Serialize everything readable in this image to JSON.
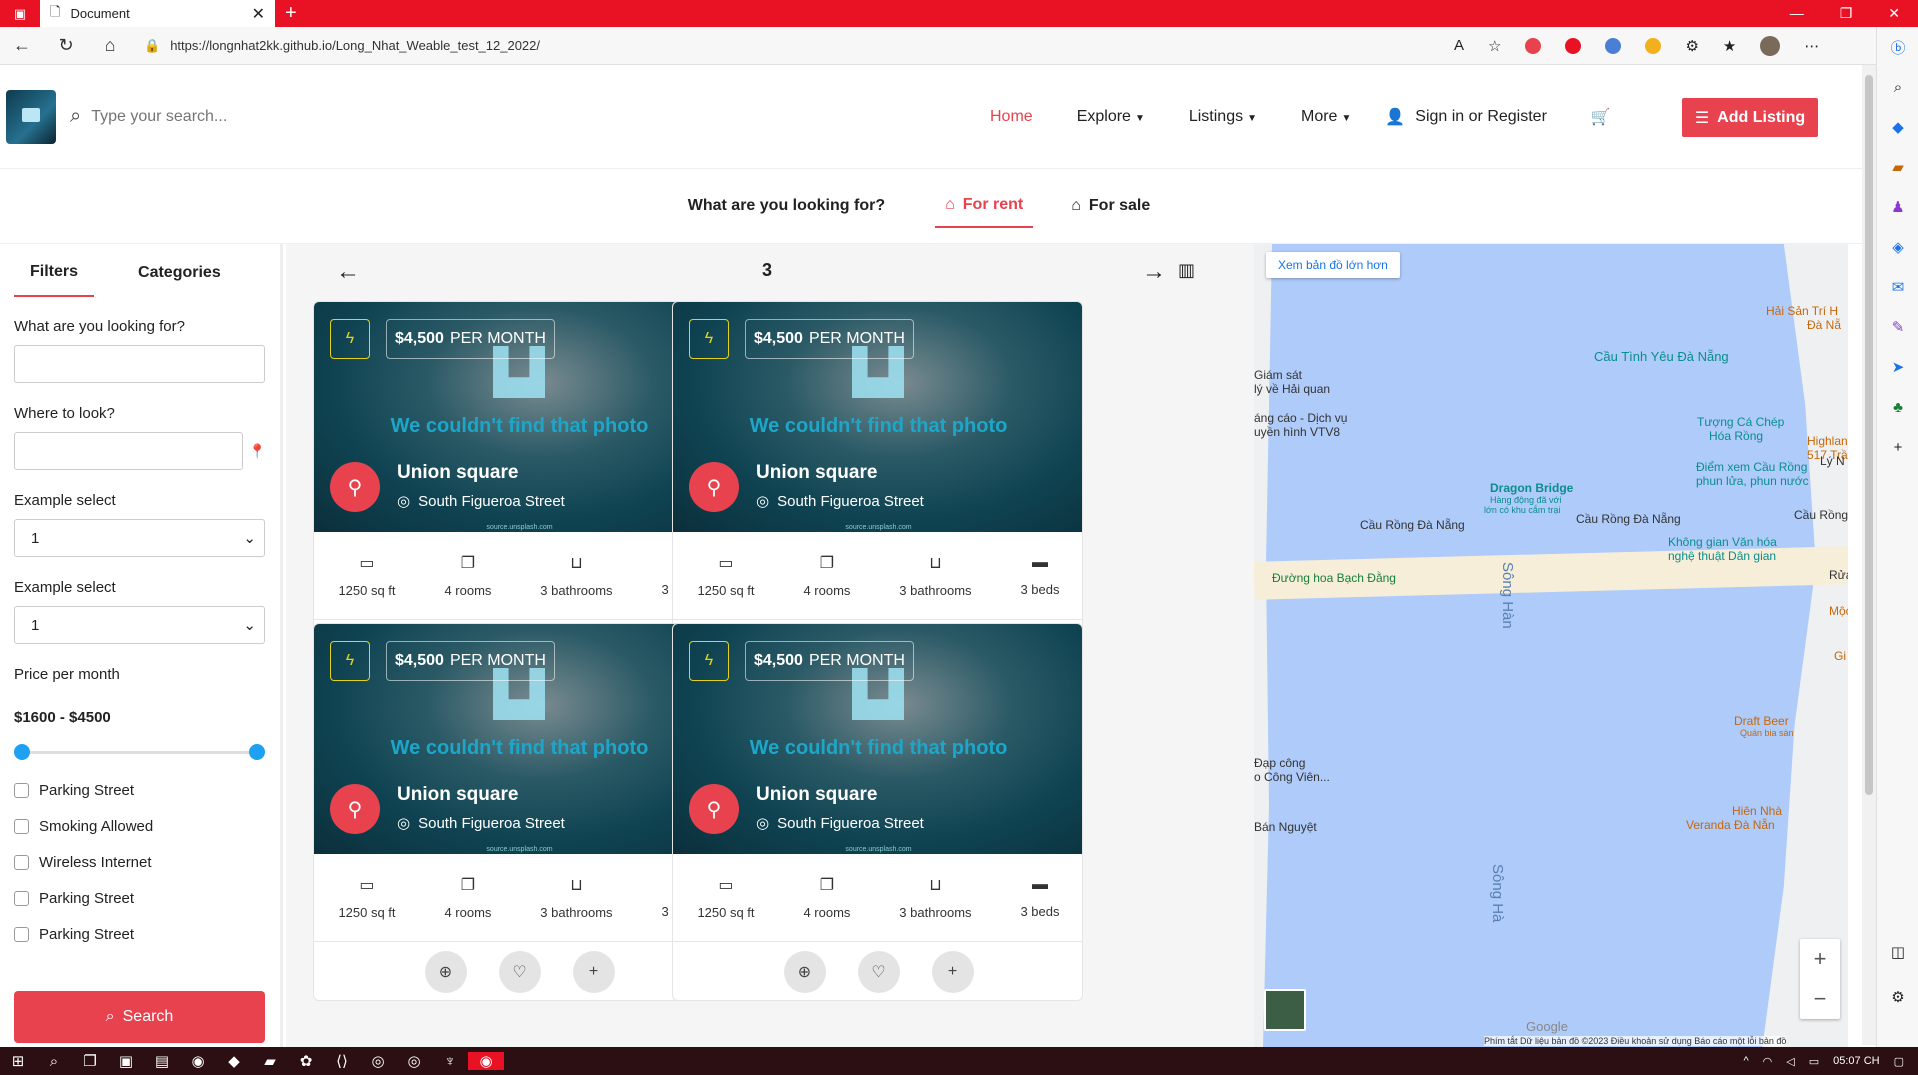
{
  "browser": {
    "tab_title": "Document",
    "url": "https://longnhat2kk.github.io/Long_Nhat_Weable_test_12_2022/"
  },
  "header": {
    "search_placeholder": "Type your search...",
    "nav": [
      "Home",
      "Explore",
      "Listings",
      "More"
    ],
    "signin": "Sign in or Register",
    "add_listing": "Add Listing"
  },
  "subtabs": {
    "question": "What are you looking for?",
    "for_rent": "For rent",
    "for_sale": "For sale"
  },
  "filters": {
    "tab_filters": "Filters",
    "tab_categories": "Categories",
    "label_what": "What are you looking for?",
    "label_where": "Where to look?",
    "label_select1": "Example select",
    "select1_value": "1",
    "label_select2": "Example select",
    "select2_value": "1",
    "label_price": "Price per month",
    "price_range": "$1600 - $4500",
    "price_min_fraction": 0,
    "price_max_fraction": 1,
    "checkboxes": [
      "Parking Street",
      "Smoking Allowed",
      "Wireless Internet",
      "Parking Street",
      "Parking Street"
    ],
    "search_button": "Search"
  },
  "pager": {
    "page": "3"
  },
  "card": {
    "price": "$4,500",
    "per": "PER MONTH",
    "photo_missing": "We couldn't find that photo",
    "photo_source": "source.unsplash.com",
    "title": "Union square",
    "address": "South Figueroa Street",
    "area": "1250 sq ft",
    "rooms": "4 rooms",
    "bathrooms": "3 bathrooms",
    "beds": "3 beds"
  },
  "map": {
    "larger_map": "Xem bản đồ lớn hơn",
    "labels": {
      "cau_tinh_yeu": "Cầu Tình Yêu Đà Nẵng",
      "tuong_ca_chep_1": "Tượng Cá Chép",
      "tuong_ca_chep_2": "Hóa Rồng",
      "hai_san_1": "Hải Sản Trí H",
      "hai_san_2": "Đà Nẵ",
      "highlands_1": "Highlan",
      "highlands_2": "517 Trầ",
      "giam_sat_1": "Giám sát",
      "giam_sat_2": "lý về Hải quan",
      "quang_cao_1": "áng cáo - Dịch vụ",
      "quang_cao_2": "uyền hình VTV8",
      "ly_n": "Lý N",
      "diem_xem_1": "Điểm xem Cầu Rồng",
      "diem_xem_2": "phun lửa, phun nước",
      "dragon_bridge": "Dragon Bridge",
      "dragon_sub_1": "Hàng động đã với",
      "dragon_sub_2": "lớn có khu cắm trại",
      "cau_rong_1": "Cầu Rồng Đà Nẵng",
      "cau_rong_2": "Cầu Rồng Đà Nẵng",
      "cau_rong_3": "Cầu Rồng",
      "khong_gian_1": "Không gian Văn hóa",
      "khong_gian_2": "nghệ thuật Dân gian",
      "duong_hoa": "Đường hoa Bạch Đằng",
      "song_han": "Sông Hàn",
      "song_han_2": "Sông Hà",
      "rua": "Rửa",
      "moc": "Mộc",
      "gi": "Gi",
      "draft_beer_1": "Draft Beer",
      "draft_beer_2": "Quán bia sàn",
      "dap_cong_1": "Ðạp công",
      "dap_cong_2": "o Công Viên...",
      "ban_nguyet": "Bán Nguyệt",
      "hien_nha_1": "Hiên Nhà",
      "hien_nha_2": "Veranda Đà Nẵn",
      "google": "Google",
      "attribution": "Phím tắt   Dữ liệu bản đồ ©2023   Điều khoản sử dụng   Báo cáo một lỗi bản đồ"
    }
  },
  "taskbar": {
    "time": "05:07 CH"
  }
}
